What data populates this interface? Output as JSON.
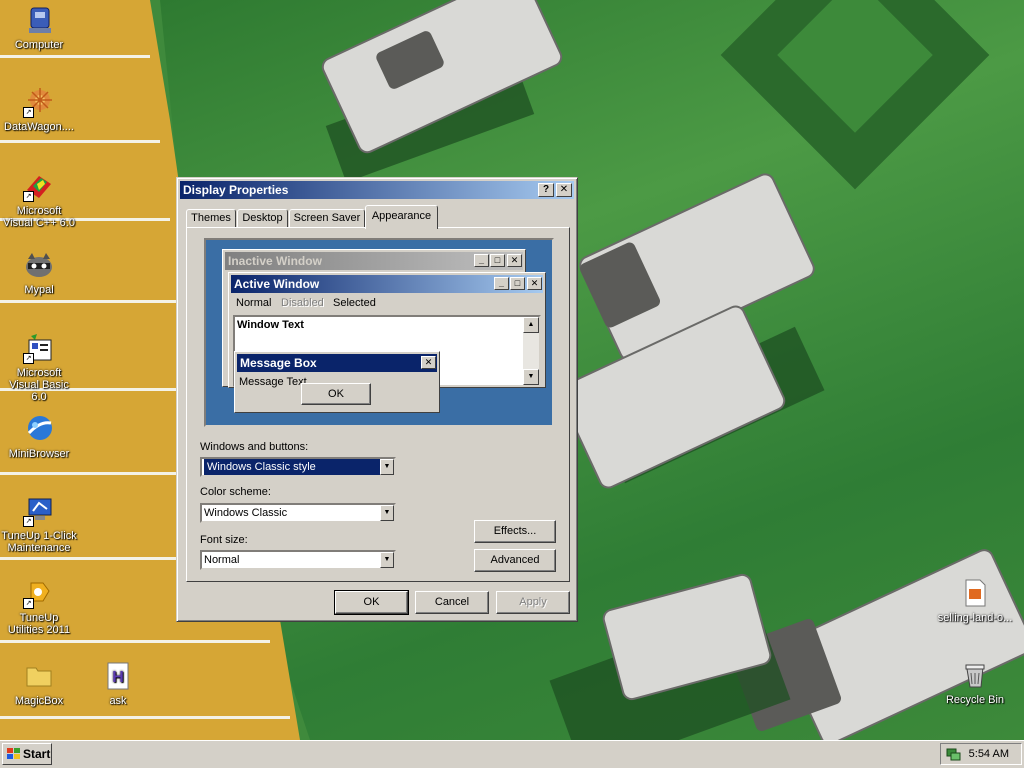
{
  "desktop": {
    "icons": [
      {
        "label": "Computer",
        "icon": "computer-icon",
        "shortcut": false
      },
      {
        "label": "DataWagon....",
        "icon": "datawagon-icon",
        "shortcut": true
      },
      {
        "label": "Microsoft Visual C++ 6.0",
        "icon": "visual-cpp-icon",
        "shortcut": true
      },
      {
        "label": "Mypal",
        "icon": "mypal-raccoon-icon",
        "shortcut": false
      },
      {
        "label": "Microsoft Visual Basic 6.0",
        "icon": "visual-basic-icon",
        "shortcut": true
      },
      {
        "label": "MiniBrowser",
        "icon": "minibrowser-globe-icon",
        "shortcut": false
      },
      {
        "label": "TuneUp 1-Click Maintenance",
        "icon": "tuneup-monitor-icon",
        "shortcut": true
      },
      {
        "label": "TuneUp Utilities 2011",
        "icon": "tuneup-utilities-icon",
        "shortcut": true
      },
      {
        "label": "MagicBox",
        "icon": "folder-icon",
        "shortcut": false
      },
      {
        "label": "ask",
        "icon": "h-document-icon",
        "shortcut": false
      },
      {
        "label": "selling-land-o...",
        "icon": "document-icon",
        "shortcut": false
      },
      {
        "label": "Recycle Bin",
        "icon": "recycle-bin-icon",
        "shortcut": false
      }
    ]
  },
  "dialog": {
    "title": "Display Properties",
    "help_glyph": "?",
    "close_glyph": "✕",
    "tabs": [
      {
        "label": "Themes"
      },
      {
        "label": "Desktop"
      },
      {
        "label": "Screen Saver"
      },
      {
        "label": "Appearance",
        "active": true
      }
    ],
    "preview": {
      "inactive_title": "Inactive Window",
      "active_title": "Active Window",
      "menu": {
        "normal": "Normal",
        "disabled": "Disabled",
        "selected": "Selected"
      },
      "window_text": "Window Text",
      "message_box_title": "Message Box",
      "message_text": "Message Text",
      "ok": "OK"
    },
    "fields": {
      "windows_buttons_label": "Windows and buttons:",
      "windows_buttons_value": "Windows Classic style",
      "color_scheme_label": "Color scheme:",
      "color_scheme_value": "Windows Classic",
      "font_size_label": "Font size:",
      "font_size_value": "Normal"
    },
    "buttons": {
      "effects": "Effects...",
      "advanced": "Advanced",
      "ok": "OK",
      "cancel": "Cancel",
      "apply": "Apply"
    }
  },
  "taskbar": {
    "start": "Start",
    "clock": "5:54 AM"
  },
  "colors": {
    "title_active": "#0a246a",
    "title_gradient_end": "#a6caf0",
    "face": "#d4d0c8",
    "preview_desktop": "#3a6ea5"
  }
}
